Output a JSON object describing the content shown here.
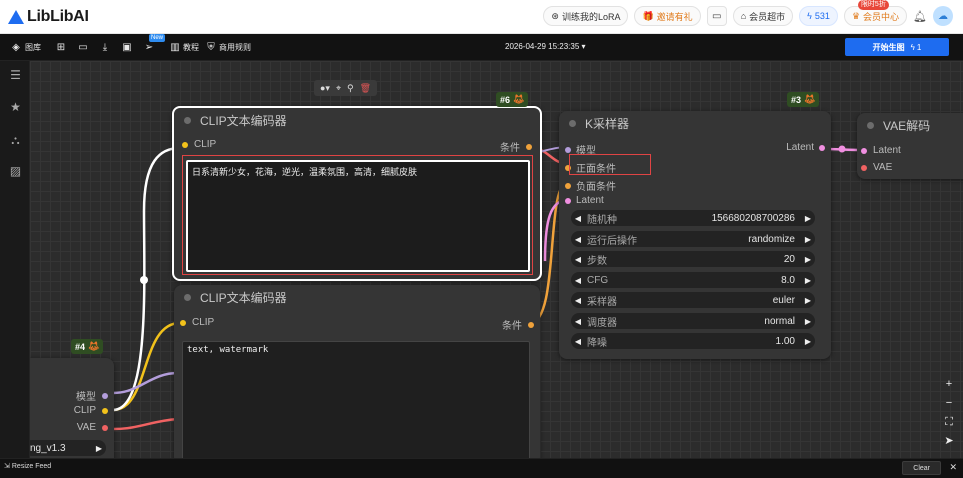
{
  "brand": {
    "name": "LibLibAI"
  },
  "topbar": {
    "train_lora": "训练我的LoRA",
    "invite": "邀请有礼",
    "supermarket": "会员超市",
    "points": "531",
    "member_center": "会员中心",
    "sale_badge": "限时5折",
    "icons": [
      "lora-icon",
      "gift-icon",
      "folder-icon",
      "store-icon",
      "lightning-icon",
      "crown-icon",
      "bell-icon",
      "avatar"
    ]
  },
  "toolbar": {
    "library": "图库",
    "new_badge": "New",
    "tutorial": "教程",
    "rules": "商用规则",
    "datetime": "2026-04-29 15:23:35",
    "run_label": "开始生图",
    "run_count": "1"
  },
  "nodes": {
    "clip_pos": {
      "title": "CLIP文本编码器",
      "tag": "#6",
      "input": "CLIP",
      "output": "条件",
      "text": "日系清新少女，花海，逆光，温柔氛围，高清，细腻皮肤"
    },
    "clip_neg": {
      "title": "CLIP文本编码器",
      "input": "CLIP",
      "output": "条件",
      "text": "text, watermark"
    },
    "ksampler": {
      "title": "K采样器",
      "tag": "#3",
      "inputs": [
        "模型",
        "正面条件",
        "负面条件",
        "Latent"
      ],
      "output": "Latent",
      "widgets": [
        {
          "label": "随机种",
          "value": "156680208700286"
        },
        {
          "label": "运行后操作",
          "value": "randomize"
        },
        {
          "label": "步数",
          "value": "20"
        },
        {
          "label": "CFG",
          "value": "8.0"
        },
        {
          "label": "采样器",
          "value": "euler"
        },
        {
          "label": "调度器",
          "value": "normal"
        },
        {
          "label": "降噪",
          "value": "1.00"
        }
      ]
    },
    "vae_decode": {
      "title": "VAE解码",
      "inputs": [
        "Latent",
        "VAE"
      ]
    },
    "checkpoint": {
      "tag": "#4",
      "outputs": [
        "模型",
        "CLIP",
        "VAE"
      ],
      "model_name": "ng_v1.3"
    }
  },
  "bottombar": {
    "resize": "Resize Feed",
    "clear": "Clear"
  },
  "colors": {
    "accent": "#1e6cf0",
    "clip": "#f2c21b",
    "model": "#b39ddb",
    "conditioning": "#f0a23b",
    "latent": "#f08fe0",
    "vae": "#f06262",
    "highlight": "#e04444"
  }
}
